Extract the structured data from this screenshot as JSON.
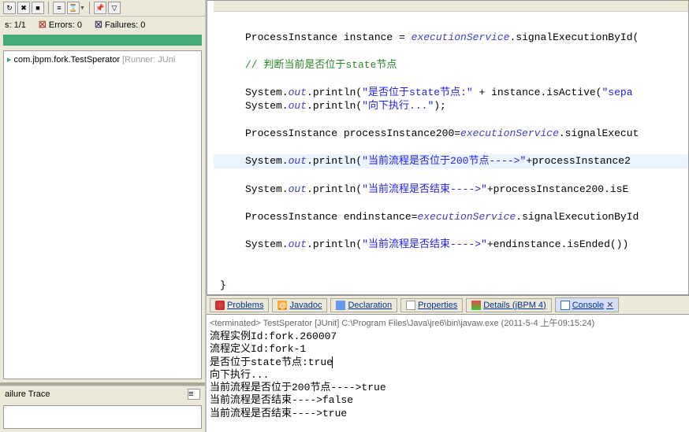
{
  "junit": {
    "runs_label": "s:",
    "runs_count": "1/1",
    "errors_label": "Errors:",
    "errors_count": "0",
    "failures_label": "Failures:",
    "failures_count": "0",
    "test_item": "com.jbpm.fork.TestSperator",
    "test_runner": "[Runner: JUni",
    "failure_trace_label": "ailure Trace"
  },
  "editor": {
    "l01_a": "ProcessInstance instance = ",
    "l01_b": "executionService",
    "l01_c": ".signalExecutionById(",
    "l02_comment": "// 判断当前是否位于state节点",
    "l03_a": "System.",
    "l03_b": "out",
    "l03_c": ".println(",
    "l03_d": "\"是否位于state节点:\"",
    "l03_e": " + instance.isActive(",
    "l03_f": "\"sepa",
    "l04_a": "System.",
    "l04_b": "out",
    "l04_c": ".println(",
    "l04_d": "\"向下执行...\"",
    "l04_e": ");",
    "l05_a": "ProcessInstance processInstance200=",
    "l05_b": "executionService",
    "l05_c": ".signalExecut",
    "l06_a": "System.",
    "l06_b": "out",
    "l06_c": ".println(",
    "l06_d": "\"当前流程是否位于200节点---->\"",
    "l06_e": "+processInstance2",
    "l07_a": "System.",
    "l07_b": "out",
    "l07_c": ".println(",
    "l07_d": "\"当前流程是否结束---->\"",
    "l07_e": "+processInstance200.isE",
    "l08_a": "ProcessInstance endinstance=",
    "l08_b": "executionService",
    "l08_c": ".signalExecutionById",
    "l09_a": "System.",
    "l09_b": "out",
    "l09_c": ".println(",
    "l09_d": "\"当前流程是否结束---->\"",
    "l09_e": "+endinstance.isEnded())",
    "brace1": "}",
    "brace2": "}"
  },
  "tabs": {
    "problems": "Problems",
    "javadoc": "Javadoc",
    "declaration": "Declaration",
    "properties": "Properties",
    "details": "Details (jBPM 4)",
    "console": "Console"
  },
  "console": {
    "term_head": "<terminated> TestSperator [JUnit] C:\\Program Files\\Java\\jre6\\bin\\javaw.exe (2011-5-4 上午09:15:24)",
    "l1": "流程实例Id:fork.260007",
    "l2": "流程定义Id:fork-1",
    "l3": "是否位于state节点:true",
    "l4": "向下执行...",
    "l5": "当前流程是否位于200节点---->true",
    "l6": "当前流程是否结束---->false",
    "l7": "当前流程是否结束---->true"
  }
}
